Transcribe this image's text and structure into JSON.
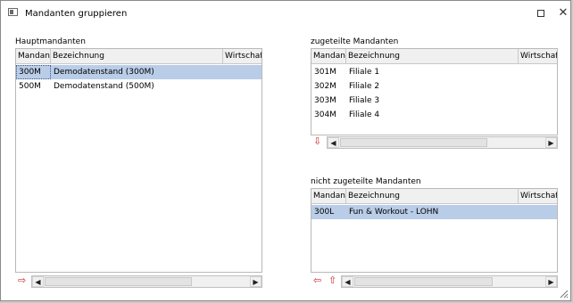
{
  "window": {
    "title": "Mandanten gruppieren",
    "maximize_icon": "maximize-icon",
    "close_icon": "close-icon"
  },
  "hauptmandanten": {
    "label": "Hauptmandanten",
    "columns": [
      "Mandant",
      "Bezeichnung",
      "Wirtschafts"
    ],
    "rows": [
      {
        "mandant": "300M",
        "bezeichnung": "Demodatenstand (300M)",
        "selected": true
      },
      {
        "mandant": "500M",
        "bezeichnung": "Demodatenstand (500M)",
        "selected": false
      }
    ],
    "action_icon": "arrow-right-icon"
  },
  "zugeteilte": {
    "label": "zugeteilte Mandanten",
    "columns": [
      "Mandant",
      "Bezeichnung",
      "Wirtschafts"
    ],
    "rows": [
      {
        "mandant": "301M",
        "bezeichnung": "Filiale 1"
      },
      {
        "mandant": "302M",
        "bezeichnung": "Filiale 2"
      },
      {
        "mandant": "303M",
        "bezeichnung": "Filiale 3"
      },
      {
        "mandant": "304M",
        "bezeichnung": "Filiale 4"
      }
    ],
    "action_icon": "arrow-down-icon"
  },
  "nicht_zugeteilte": {
    "label": "nicht zugeteilte Mandanten",
    "columns": [
      "Mandant",
      "Bezeichnung",
      "Wirtschafts"
    ],
    "rows": [
      {
        "mandant": "300L",
        "bezeichnung": "Fun & Workout - LOHN",
        "selected": true
      }
    ],
    "action_icons": [
      "arrow-left-icon",
      "arrow-up-icon"
    ]
  },
  "colors": {
    "selection": "#b9cde8",
    "action_arrow": "#cc2a2a"
  }
}
